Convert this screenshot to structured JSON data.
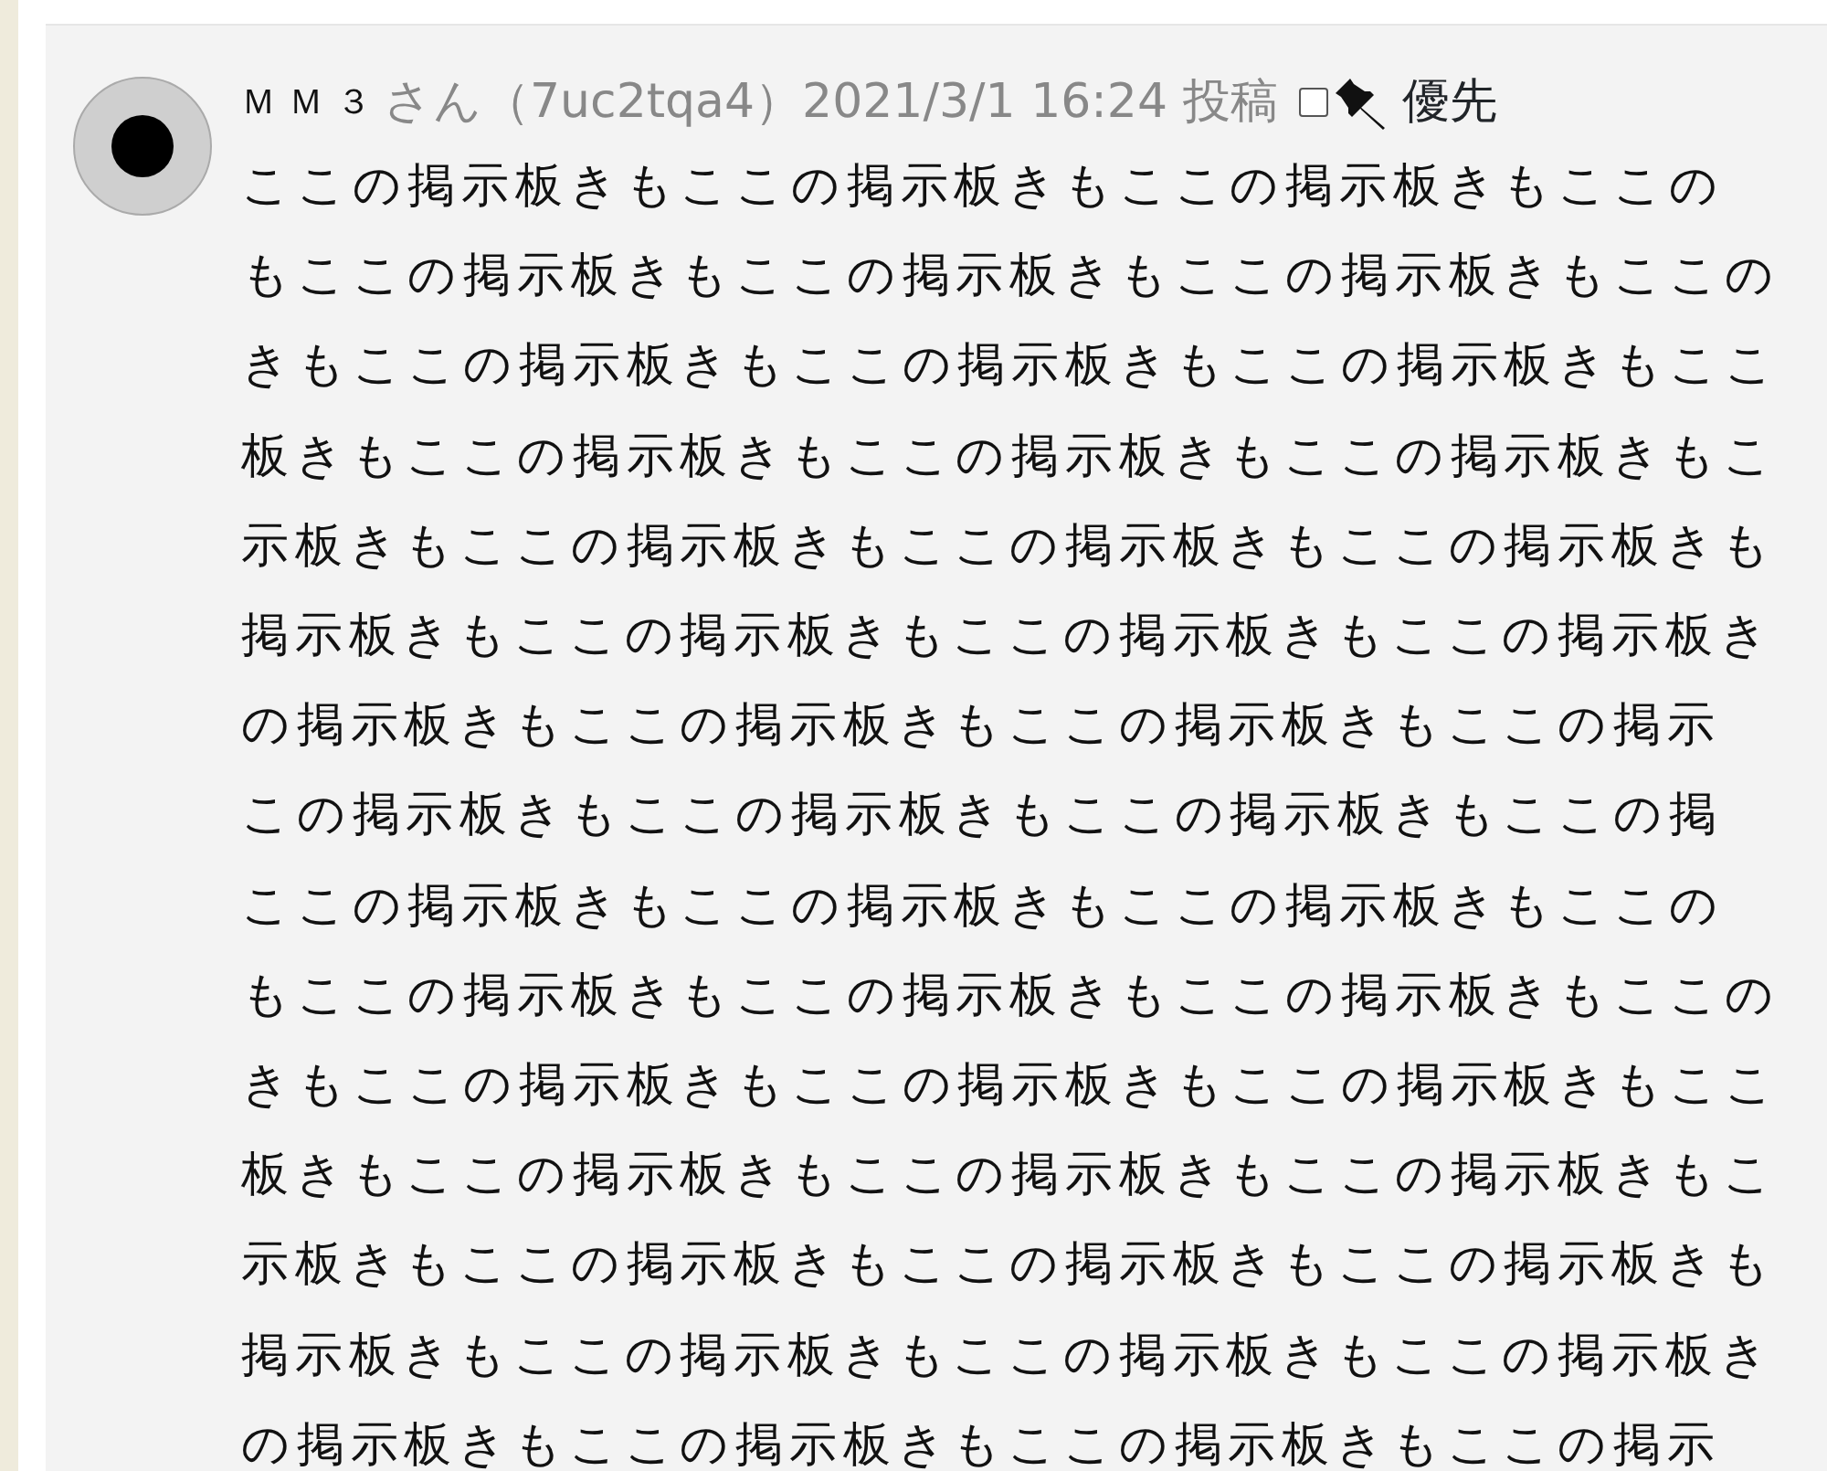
{
  "post": {
    "author": "ＭＭ３",
    "meta": "さん（7uc2tqa4）2021/3/1 16:24 投稿",
    "priority": {
      "label": "優先",
      "checked": false
    },
    "body_lines": [
      "ここの掲示板きもここの掲示板きもここの掲示板きもここの",
      "もここの掲示板きもここの掲示板きもここの掲示板きもここの",
      "きもここの掲示板きもここの掲示板きもここの掲示板きもここ",
      "板きもここの掲示板きもここの掲示板きもここの掲示板きもこ",
      "示板きもここの掲示板きもここの掲示板きもここの掲示板きも",
      "掲示板きもここの掲示板きもここの掲示板きもここの掲示板き",
      "の掲示板きもここの掲示板きもここの掲示板きもここの掲示",
      "この掲示板きもここの掲示板きもここの掲示板きもここの掲",
      "ここの掲示板きもここの掲示板きもここの掲示板きもここの",
      "もここの掲示板きもここの掲示板きもここの掲示板きもここの",
      "きもここの掲示板きもここの掲示板きもここの掲示板きもここ",
      "板きもここの掲示板きもここの掲示板きもここの掲示板きもこ",
      "示板きもここの掲示板きもここの掲示板きもここの掲示板きも",
      "掲示板きもここの掲示板きもここの掲示板きもここの掲示板き",
      "の掲示板きもここの掲示板きもここの掲示板きもここの掲示"
    ]
  }
}
